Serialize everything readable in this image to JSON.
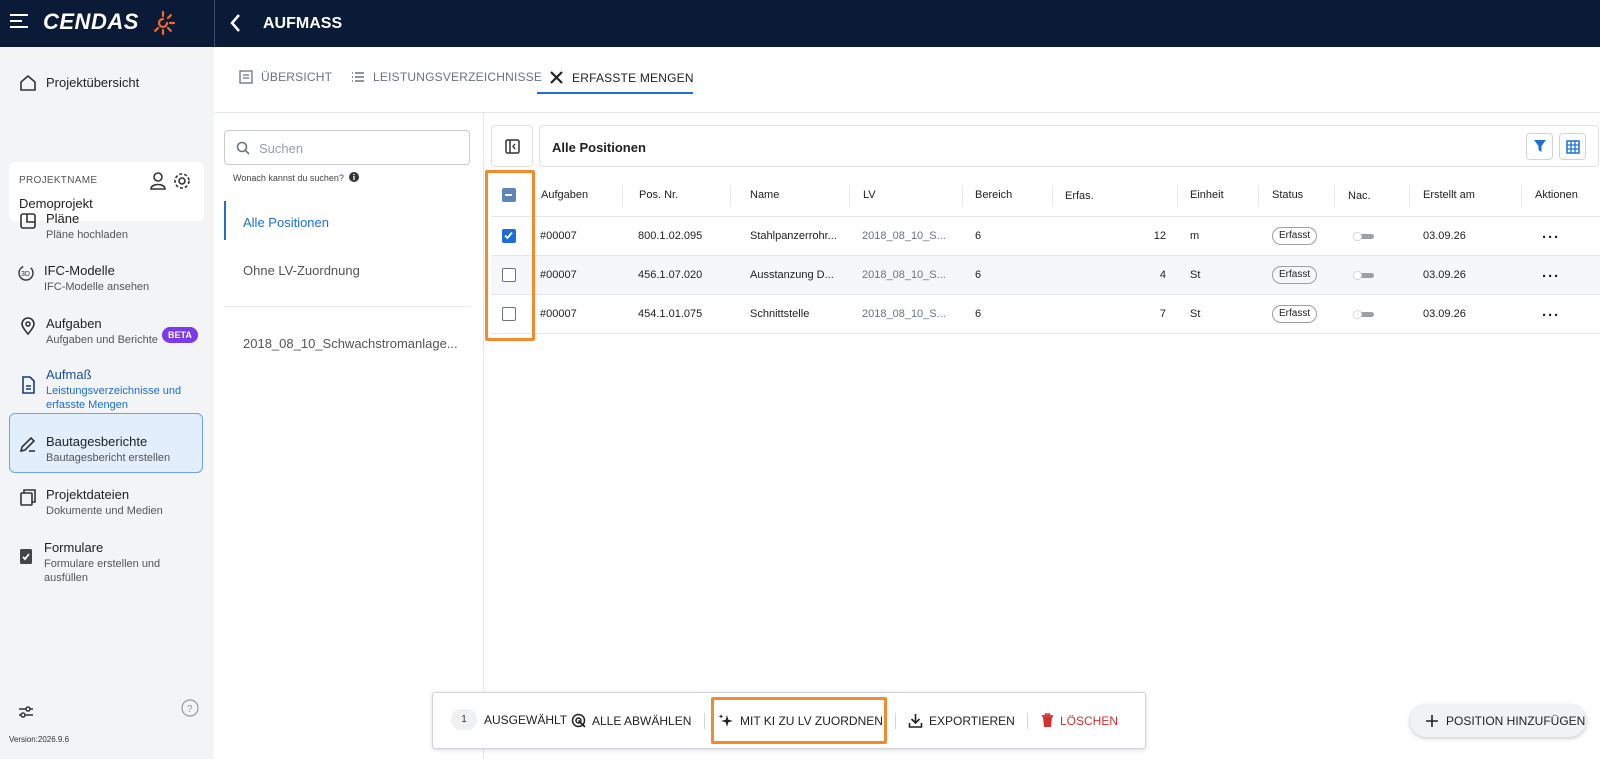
{
  "header": {
    "brand": "CENDAS",
    "title": "AUFMASS"
  },
  "sidebar": {
    "overview": "Projektübersicht",
    "project_label": "PROJEKTNAME",
    "project_name": "Demoprojekt",
    "items": [
      {
        "title": "Pläne",
        "sub": "Pläne hochladen",
        "icon": "plans-icon"
      },
      {
        "title": "IFC-Modelle",
        "sub": "IFC-Modelle ansehen",
        "icon": "3d-icon",
        "badge": "BETA"
      },
      {
        "title": "Aufgaben",
        "sub": "Aufgaben und Berichte",
        "icon": "location-pin-icon"
      },
      {
        "title": "Aufmaß",
        "sub": "Leistungsverzeichnisse und erfasste Mengen",
        "icon": "document-icon",
        "active": true
      },
      {
        "title": "Bautagesberichte",
        "sub": "Bautagesbericht erstellen",
        "icon": "pen-icon"
      },
      {
        "title": "Projektdateien",
        "sub": "Dokumente und Medien",
        "icon": "files-icon"
      },
      {
        "title": "Formulare",
        "sub": "Formulare erstellen und ausfüllen",
        "icon": "clipboard-icon"
      }
    ],
    "version": "Version:2026.9.6"
  },
  "tabs": [
    {
      "label": "ÜBERSICHT"
    },
    {
      "label": "LEISTUNGSVERZEICHNISSE"
    },
    {
      "label": "ERFASSTE MENGEN",
      "active": true
    }
  ],
  "filter": {
    "search_placeholder": "Suchen",
    "hint": "Wonach kannst du suchen?",
    "items": [
      "Alle Positionen",
      "Ohne LV-Zuordnung",
      "2018_08_10_Schwachstromanlage..."
    ]
  },
  "table": {
    "title": "Alle Positionen",
    "columns": [
      "Aufgaben",
      "Pos. Nr.",
      "Name",
      "LV",
      "Bereich",
      "Erfas.",
      "Einheit",
      "Status",
      "Nac.",
      "Erstellt am",
      "Aktionen"
    ],
    "rows": [
      {
        "aufgaben": "#00007",
        "pos": "800.1.02.095",
        "name": "Stahlpanzerrohr...",
        "lv": "2018_08_10_S...",
        "bereich": "6",
        "erfas": "12",
        "einheit": "m",
        "status": "Erfasst",
        "erstellt": "03.09.26",
        "checked": true
      },
      {
        "aufgaben": "#00007",
        "pos": "456.1.07.020",
        "name": "Ausstanzung D...",
        "lv": "2018_08_10_S...",
        "bereich": "6",
        "erfas": "4",
        "einheit": "St",
        "status": "Erfasst",
        "erstellt": "03.09.26",
        "checked": false
      },
      {
        "aufgaben": "#00007",
        "pos": "454.1.01.075",
        "name": "Schnittstelle",
        "lv": "2018_08_10_S...",
        "bereich": "6",
        "erfas": "7",
        "einheit": "St",
        "status": "Erfasst",
        "erstellt": "03.09.26",
        "checked": false
      }
    ]
  },
  "actionbar": {
    "count": "1",
    "selected": "AUSGEWÄHLT",
    "deselect": "ALLE ABWÄHLEN",
    "ai_assign": "MIT KI ZU LV ZUORDNEN",
    "export": "EXPORTIEREN",
    "delete": "LÖSCHEN"
  },
  "fab": {
    "label": "POSITION HINZUFÜGEN"
  },
  "colors": {
    "navy": "#0b1a36",
    "accent": "#1d6fd6",
    "highlight": "#f28a2e",
    "danger": "#d32f2f",
    "beta": "#7c3aed"
  }
}
